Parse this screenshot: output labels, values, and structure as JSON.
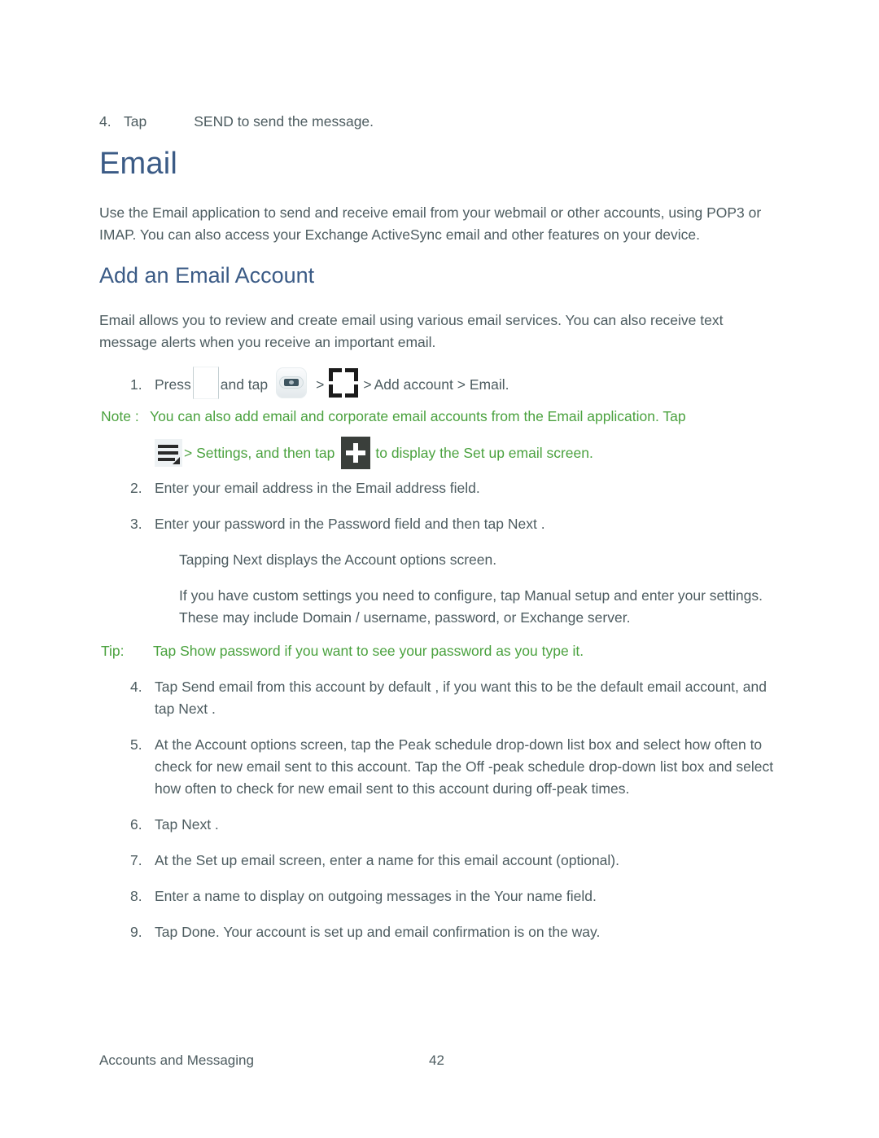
{
  "document": {
    "top_step": {
      "number": "4.",
      "tap_word": "Tap",
      "text": "SEND to send the message.",
      "icon": "blank-send-icon"
    },
    "h1": "Email",
    "intro": "Use the Email application to send and receive email from your webmail or other accounts, using POP3 or IMAP. You can also access your Exchange ActiveSync email and other features on your device.",
    "h2": "Add an Email Account",
    "subintro": "Email allows you to review and create email using various email services. You can also receive text message alerts when you receive an important email.",
    "step1": {
      "number": "1.",
      "press_word": "Press",
      "and_tap_word": "and tap",
      "gt1": ">",
      "gt2": ">",
      "add_account": "Add account >",
      "email_word": "Email."
    },
    "note": {
      "label": "Note :",
      "line1": "You can also add email and corporate email accounts from the Email application. Tap",
      "line2_part1": "> Settings, and then tap",
      "line2_part2": "to display the Set up email  screen."
    },
    "steps": [
      {
        "number": "2.",
        "text": "Enter your email address in the Email address  field."
      },
      {
        "number": "3.",
        "text": "Enter your password in the Password  field and then tap Next ."
      }
    ],
    "sub_paragraphs": [
      "Tapping Next displays the Account options screen.",
      "If you have custom settings you need to configure, tap Manual setup  and enter your settings. These may include Domain / username, password, or Exchange server."
    ],
    "tip": {
      "label": "Tip:",
      "text": "Tap Show password  if you want to see your password as you type it."
    },
    "steps_after_tip": [
      {
        "number": "4.",
        "text": "Tap Send email from this  account by default , if you want this to be the default email account, and tap Next ."
      },
      {
        "number": "5.",
        "text": "At the Account options  screen, tap the Peak schedule  drop-down list box and select how often to check for new email sent to this account. Tap the Off -peak schedule drop-down list box and select how often to check for new email sent to this account during off-peak times."
      },
      {
        "number": "6.",
        "text": "Tap Next ."
      },
      {
        "number": "7.",
        "text": "At the Set up email  screen, enter a name for this email account (optional)."
      },
      {
        "number": "8.",
        "text": "Enter a name to display on outgoing messages in the Your name  field."
      },
      {
        "number": "9.",
        "text": "Tap Done. Your account is set up and email confirmation is on the way."
      }
    ],
    "footer": {
      "section_title": "Accounts and Messaging",
      "page_number": "42"
    },
    "colors": {
      "heading_blue": "#3b5b86",
      "body_gray": "#4d5c60",
      "note_green": "#4ba23f",
      "plus_icon_bg": "#3a3f3b",
      "menu_icon_bg": "#eef2f4"
    }
  }
}
